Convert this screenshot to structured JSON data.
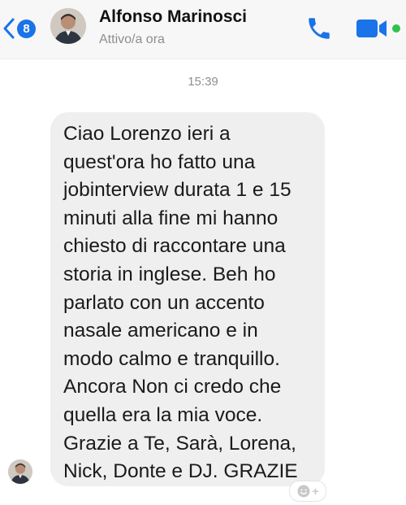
{
  "header": {
    "unread_count": "8",
    "contact_name": "Alfonso Marinosci",
    "status": "Attivo/a ora",
    "accent_color": "#1a73e8",
    "online_color": "#31c24d"
  },
  "conversation": {
    "timestamp": "15:39",
    "message_lines": [
      "Ciao Lorenzo ieri a",
      "quest'ora ho fatto una",
      "jobinterview durata 1 e 15",
      "minuti alla fine mi hanno",
      "chiesto di raccontare una",
      "storia in inglese. Beh ho",
      "parlato con un accento",
      "nasale americano e in",
      "modo calmo e tranquillo.",
      "Ancora Non ci credo che",
      "quella era la mia voce.",
      "Grazie a Te, Sarà, Lorena,",
      "Nick, Donte e DJ.  GRAZIE"
    ],
    "reaction_button": "+"
  },
  "icons": {
    "back": "chevron-left-icon",
    "call": "phone-icon",
    "video": "video-camera-icon",
    "reaction": "smiley-plus-icon"
  }
}
